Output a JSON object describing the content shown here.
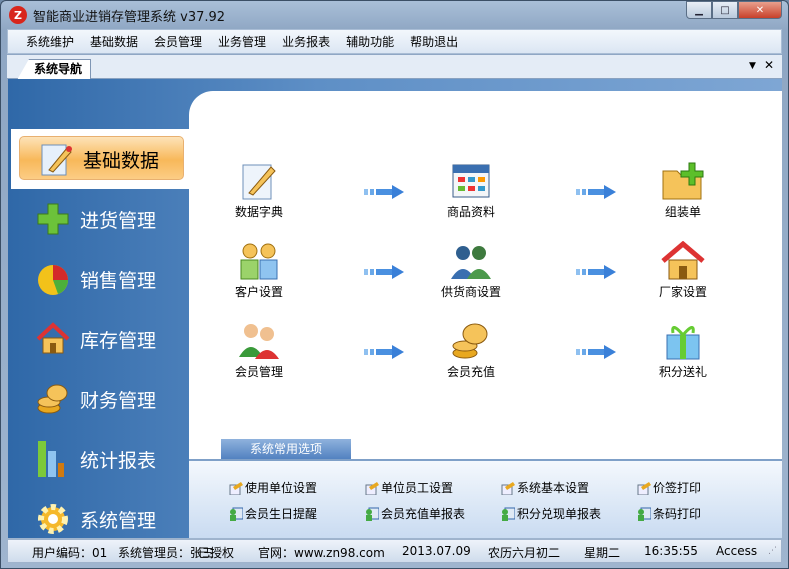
{
  "window": {
    "title": "智能商业进销存管理系统 v37.92",
    "logo_icon": "brand-logo-icon",
    "buttons": [
      "minimize",
      "maximize",
      "close"
    ]
  },
  "menu": [
    "系统维护",
    "基础数据",
    "会员管理",
    "业务管理",
    "业务报表",
    "辅助功能",
    "帮助退出"
  ],
  "tab": {
    "label": "系统导航",
    "dropdown_icon": "▼",
    "close_icon": "✕"
  },
  "sidebar": [
    {
      "label": "基础数据",
      "icon": "pencil-doc-icon",
      "active": true
    },
    {
      "label": "进货管理",
      "icon": "green-plus-icon"
    },
    {
      "label": "销售管理",
      "icon": "pie-chart-icon"
    },
    {
      "label": "库存管理",
      "icon": "house-icon"
    },
    {
      "label": "财务管理",
      "icon": "coins-icon"
    },
    {
      "label": "统计报表",
      "icon": "bar-chart-icon"
    },
    {
      "label": "系统管理",
      "icon": "gear-icon"
    }
  ],
  "grid": [
    {
      "label": "数据字典",
      "icon": "dictionary-icon"
    },
    {
      "label": "商品资料",
      "icon": "calendar-grid-icon"
    },
    {
      "label": "组装单",
      "icon": "folder-add-icon"
    },
    {
      "label": "客户设置",
      "icon": "customers-icon"
    },
    {
      "label": "供货商设置",
      "icon": "suppliers-icon"
    },
    {
      "label": "厂家设置",
      "icon": "house-icon"
    },
    {
      "label": "会员管理",
      "icon": "members-icon"
    },
    {
      "label": "会员充值",
      "icon": "coins-icon"
    },
    {
      "label": "积分送礼",
      "icon": "gift-icon"
    }
  ],
  "options": {
    "tab_label": "系统常用选项",
    "items": [
      {
        "label": "使用单位设置",
        "icon": "settings-doc-icon"
      },
      {
        "label": "单位员工设置",
        "icon": "settings-doc-icon"
      },
      {
        "label": "系统基本设置",
        "icon": "settings-doc-icon"
      },
      {
        "label": "价签打印",
        "icon": "settings-doc-icon"
      },
      {
        "label": "会员生日提醒",
        "icon": "user-report-icon"
      },
      {
        "label": "会员充值单报表",
        "icon": "user-report-icon"
      },
      {
        "label": "积分兑现单报表",
        "icon": "user-report-icon"
      },
      {
        "label": "条码打印",
        "icon": "user-report-icon"
      }
    ]
  },
  "status": {
    "user_code": "用户编码：01",
    "user": "系统管理员：张三",
    "auth": "已授权",
    "site": "官网：www.zn98.com",
    "date": "2013.07.09",
    "lunar": "农历六月初二",
    "weekday": "星期二",
    "time": "16:35:55",
    "db": "Access"
  }
}
